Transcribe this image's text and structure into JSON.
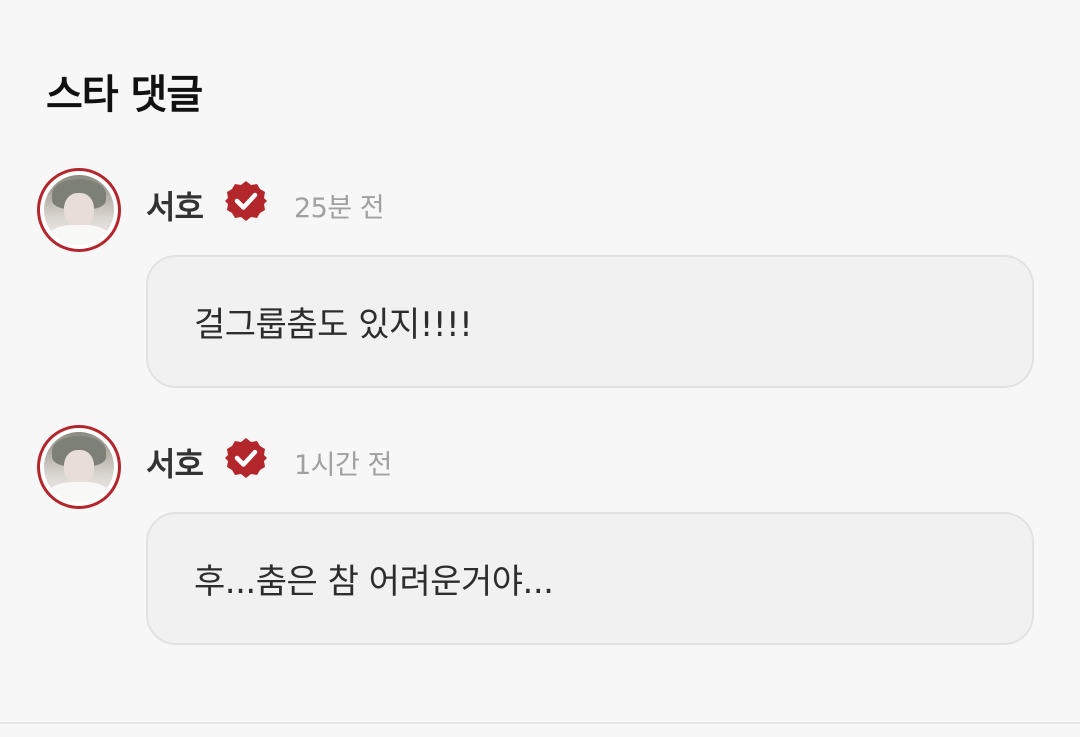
{
  "section": {
    "title": "스타 댓글"
  },
  "comments": [
    {
      "author": "서호",
      "time": "25분 전",
      "text": "걸그룹춤도 있지!!!!",
      "avatar_icon": "profile-photo",
      "badge_icon": "verified-badge-icon"
    },
    {
      "author": "서호",
      "time": "1시간 전",
      "text": "후...춤은 참 어려운거야...",
      "avatar_icon": "profile-photo",
      "badge_icon": "verified-badge-icon"
    }
  ],
  "colors": {
    "accent": "#b3262b",
    "background": "#f7f7f7",
    "bubble": "#f1f1f1",
    "timestamp": "#a0a0a0"
  }
}
